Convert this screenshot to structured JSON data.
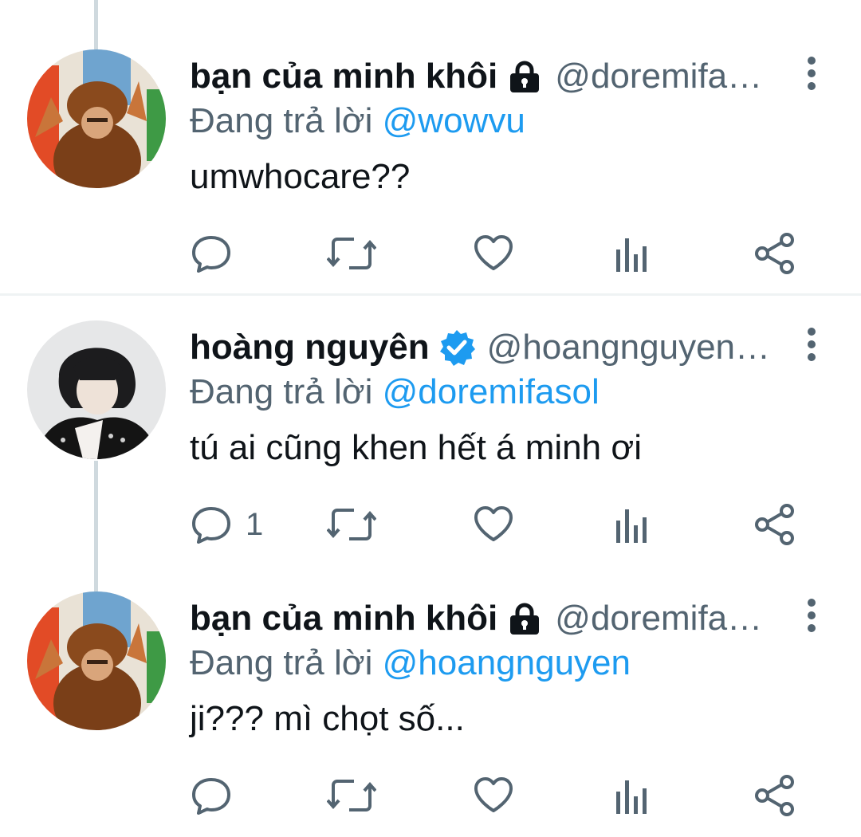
{
  "colors": {
    "text": "#0f1419",
    "secondary": "#536471",
    "accent": "#1d9bf0",
    "thread_line": "#cfd9de",
    "divider": "#eff3f4"
  },
  "tweets": [
    {
      "display_name": "bạn của minh khôi",
      "badge": "lock-icon",
      "handle": "@doremifa…",
      "reply_prefix": "Đang trả lời",
      "reply_to": "@wowvu",
      "text": "umwhocare??",
      "reply_count": "",
      "avatar": "lion-costume-kid-avatar"
    },
    {
      "display_name": "hoàng nguyên",
      "badge": "verified-badge-icon",
      "handle": "@hoangnguyen…",
      "reply_prefix": "Đang trả lời",
      "reply_to": "@doremifasol",
      "text": "tú ai cũng khen hết á minh ơi",
      "reply_count": "1",
      "avatar": "portrait-avatar"
    },
    {
      "display_name": "bạn của minh khôi",
      "badge": "lock-icon",
      "handle": "@doremifa…",
      "reply_prefix": "Đang trả lời",
      "reply_to": "@hoangnguyen",
      "text": "ji??? mì chọt số...",
      "reply_count": "",
      "avatar": "lion-costume-kid-avatar"
    }
  ],
  "action_icons": [
    "reply-icon",
    "retweet-icon",
    "like-icon",
    "views-icon",
    "share-icon"
  ]
}
